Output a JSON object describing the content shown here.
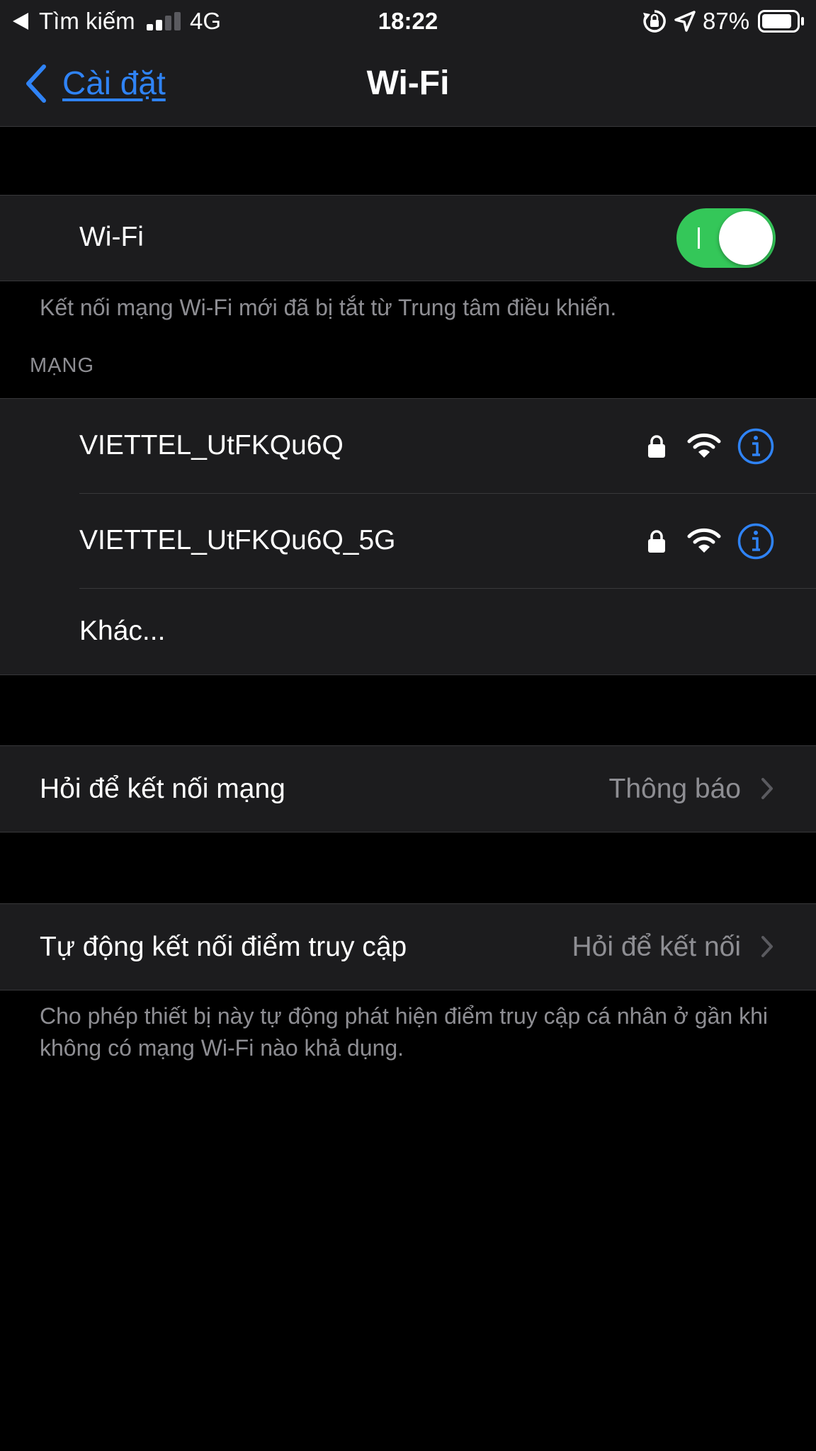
{
  "status_bar": {
    "back_app": "Tìm kiếm",
    "network": "4G",
    "time": "18:22",
    "battery_percent": "87%",
    "battery_level": 0.87
  },
  "nav": {
    "back_label": "Cài đặt",
    "title": "Wi-Fi"
  },
  "wifi": {
    "label": "Wi-Fi",
    "enabled": true,
    "note": "Kết nối mạng Wi-Fi mới đã bị tắt từ Trung tâm điều khiển."
  },
  "networks": {
    "header": "MẠNG",
    "items": [
      {
        "name": "VIETTEL_UtFKQu6Q",
        "secured": true,
        "icons": [
          "lock-icon",
          "wifi-signal-icon",
          "info-icon"
        ]
      },
      {
        "name": "VIETTEL_UtFKQu6Q_5G",
        "secured": true,
        "icons": [
          "lock-icon",
          "wifi-signal-icon",
          "info-icon"
        ]
      }
    ],
    "other_label": "Khác..."
  },
  "ask_to_join": {
    "label": "Hỏi để kết nối mạng",
    "value": "Thông báo"
  },
  "auto_hotspot": {
    "label": "Tự động kết nối điểm truy cập",
    "value": "Hỏi để kết nối",
    "footnote": "Cho phép thiết bị này tự động phát hiện điểm truy cập cá nhân ở gần khi không có mạng Wi-Fi nào khả dụng."
  },
  "colors": {
    "accent": "#2f83f6",
    "toggle_on": "#34c759",
    "background": "#000000",
    "cell": "#1c1c1e",
    "secondary_text": "#8e8e93"
  }
}
